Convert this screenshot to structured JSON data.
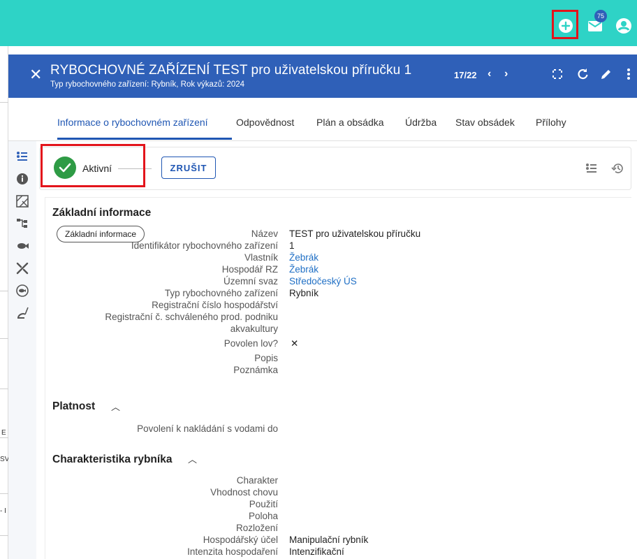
{
  "topbar": {
    "notification_count": "75",
    "colors": {
      "bar": "#2ed3c6",
      "highlight": "#e3141b"
    }
  },
  "background_app": {
    "fragments": [
      "E",
      "SV",
      "- I"
    ]
  },
  "header": {
    "title": "RYBOCHOVNÉ ZAŘÍZENÍ TEST pro uživatelskou příručku 1",
    "subtitle": "Typ rybochovného zařízení: Rybník, Rok výkazů: 2024",
    "counter": "17/22",
    "color": "#2f60b8"
  },
  "tabs": [
    {
      "label": "Informace o rybochovném zařízení",
      "active": true
    },
    {
      "label": "Odpovědnost"
    },
    {
      "label": "Plán a obsádka"
    },
    {
      "label": "Údržba"
    },
    {
      "label": "Stav obsádek"
    },
    {
      "label": "Přílohy"
    }
  ],
  "status": {
    "label": "Aktivní",
    "cancel_button": "ZRUŠIT"
  },
  "sections": {
    "basic": {
      "title": "Základní informace",
      "chip": "Základní informace",
      "fields": [
        {
          "label": "Název",
          "value": "TEST pro uživatelskou příručku"
        },
        {
          "label": "Identifikátor rybochovného zařízení",
          "value": "1"
        },
        {
          "label": "Vlastník",
          "value": "Žebrák"
        },
        {
          "label": "Hospodář RZ",
          "value": "Žebrák"
        },
        {
          "label": "Územní svaz",
          "value": "Středočeský ÚS"
        },
        {
          "label": "Typ rybochovného zařízení",
          "value": "Rybník"
        },
        {
          "label": "Registrační číslo hospodářství",
          "value": ""
        },
        {
          "label": "Registrační č. schváleného prod. podniku",
          "value": ""
        },
        {
          "label": "akvakultury",
          "value": ""
        },
        {
          "label": "Povolen lov?",
          "value": "✕"
        },
        {
          "label": "Popis",
          "value": ""
        },
        {
          "label": "Poznámka",
          "value": ""
        }
      ]
    },
    "validity": {
      "title": "Platnost",
      "fields": [
        {
          "label": "Povolení k nakládání s vodami do",
          "value": ""
        }
      ]
    },
    "pond": {
      "title": "Charakteristika rybníka",
      "fields": [
        {
          "label": "Charakter",
          "value": ""
        },
        {
          "label": "Vhodnost chovu",
          "value": ""
        },
        {
          "label": "Použití",
          "value": ""
        },
        {
          "label": "Poloha",
          "value": ""
        },
        {
          "label": "Rozložení",
          "value": ""
        },
        {
          "label": "Hospodářský účel",
          "value": "Manipulační rybník"
        },
        {
          "label": "Intenzita hospodaření",
          "value": "Intenzifikační"
        }
      ]
    }
  },
  "icons": {
    "topbar": [
      "add-circle-icon",
      "mail-icon",
      "account-icon"
    ],
    "header": [
      "close-icon",
      "chevron-left-icon",
      "chevron-right-icon",
      "fullscreen-icon",
      "refresh-icon",
      "edit-icon",
      "more-vert-icon"
    ],
    "rail": [
      "details-list-icon",
      "info-icon",
      "map-icon",
      "hierarchy-icon",
      "fish-icon",
      "tools-icon",
      "fish-circle-icon",
      "fishing-icon"
    ],
    "statusbar": [
      "check-icon",
      "options-icon",
      "history-icon"
    ]
  }
}
